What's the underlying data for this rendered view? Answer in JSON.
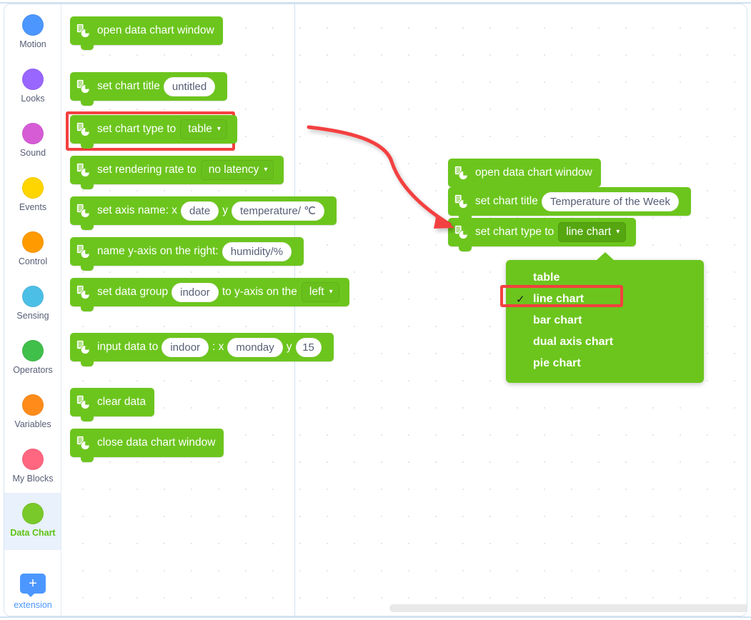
{
  "sidebar": {
    "categories": [
      {
        "label": "Motion",
        "color": "#4c97ff",
        "selected": false
      },
      {
        "label": "Looks",
        "color": "#9966ff",
        "selected": false
      },
      {
        "label": "Sound",
        "color": "#d65cd6",
        "selected": false
      },
      {
        "label": "Events",
        "color": "#ffd500",
        "selected": false
      },
      {
        "label": "Control",
        "color": "#ff9b00",
        "selected": false
      },
      {
        "label": "Sensing",
        "color": "#4cbfe6",
        "selected": false
      },
      {
        "label": "Operators",
        "color": "#40bf4a",
        "selected": false
      },
      {
        "label": "Variables",
        "color": "#ff8c1a",
        "selected": false
      },
      {
        "label": "My Blocks",
        "color": "#ff6680",
        "selected": false
      },
      {
        "label": "Data Chart",
        "color": "#7ac92a",
        "selected": true
      }
    ],
    "extension": {
      "icon": "plus-icon",
      "glyph": "+",
      "label": "extension"
    }
  },
  "palette": {
    "blocks": [
      {
        "id": "open-window",
        "text": "open data chart window"
      },
      {
        "id": "set-title",
        "text": "set chart title",
        "oval": "untitled"
      },
      {
        "id": "set-type",
        "text": "set chart type to",
        "dropdown": "table"
      },
      {
        "id": "set-rate",
        "text": "set rendering rate to",
        "dropdown": "no latency"
      },
      {
        "id": "set-axis",
        "text": "set axis name: x",
        "oval": "date",
        "mid": "y",
        "oval2": "temperature/ ℃"
      },
      {
        "id": "name-right-y",
        "text": "name y-axis on the right:",
        "oval": "humidity/%"
      },
      {
        "id": "set-group",
        "text": "set data group",
        "oval": "indoor",
        "mid": "to y-axis on the",
        "dropdown": "left"
      },
      {
        "id": "input-data",
        "text": "input data to",
        "oval": "indoor",
        "mid": ": x",
        "oval2": "monday",
        "mid2": "y",
        "oval3": "15"
      },
      {
        "id": "clear-data",
        "text": "clear data"
      },
      {
        "id": "close-window",
        "text": "close data chart window"
      }
    ]
  },
  "script": {
    "blocks": [
      {
        "id": "open-window-s",
        "text": "open data chart window"
      },
      {
        "id": "set-title-s",
        "text": "set chart title",
        "oval": "Temperature of the Week"
      },
      {
        "id": "set-type-s",
        "text": "set chart type to",
        "dropdown": "line chart"
      }
    ]
  },
  "dropdown_menu": {
    "options": [
      {
        "label": "table",
        "checked": false
      },
      {
        "label": "line chart",
        "checked": true
      },
      {
        "label": "bar chart",
        "checked": false
      },
      {
        "label": "dual axis chart",
        "checked": false
      },
      {
        "label": "pie chart",
        "checked": false
      }
    ],
    "check_glyph": "✓"
  },
  "annotations": {
    "highlight_color": "#f3403f",
    "arrow_name": "red-curved-arrow"
  },
  "icons": {
    "block_icon": "data-chart-icon",
    "caret": "▾"
  }
}
